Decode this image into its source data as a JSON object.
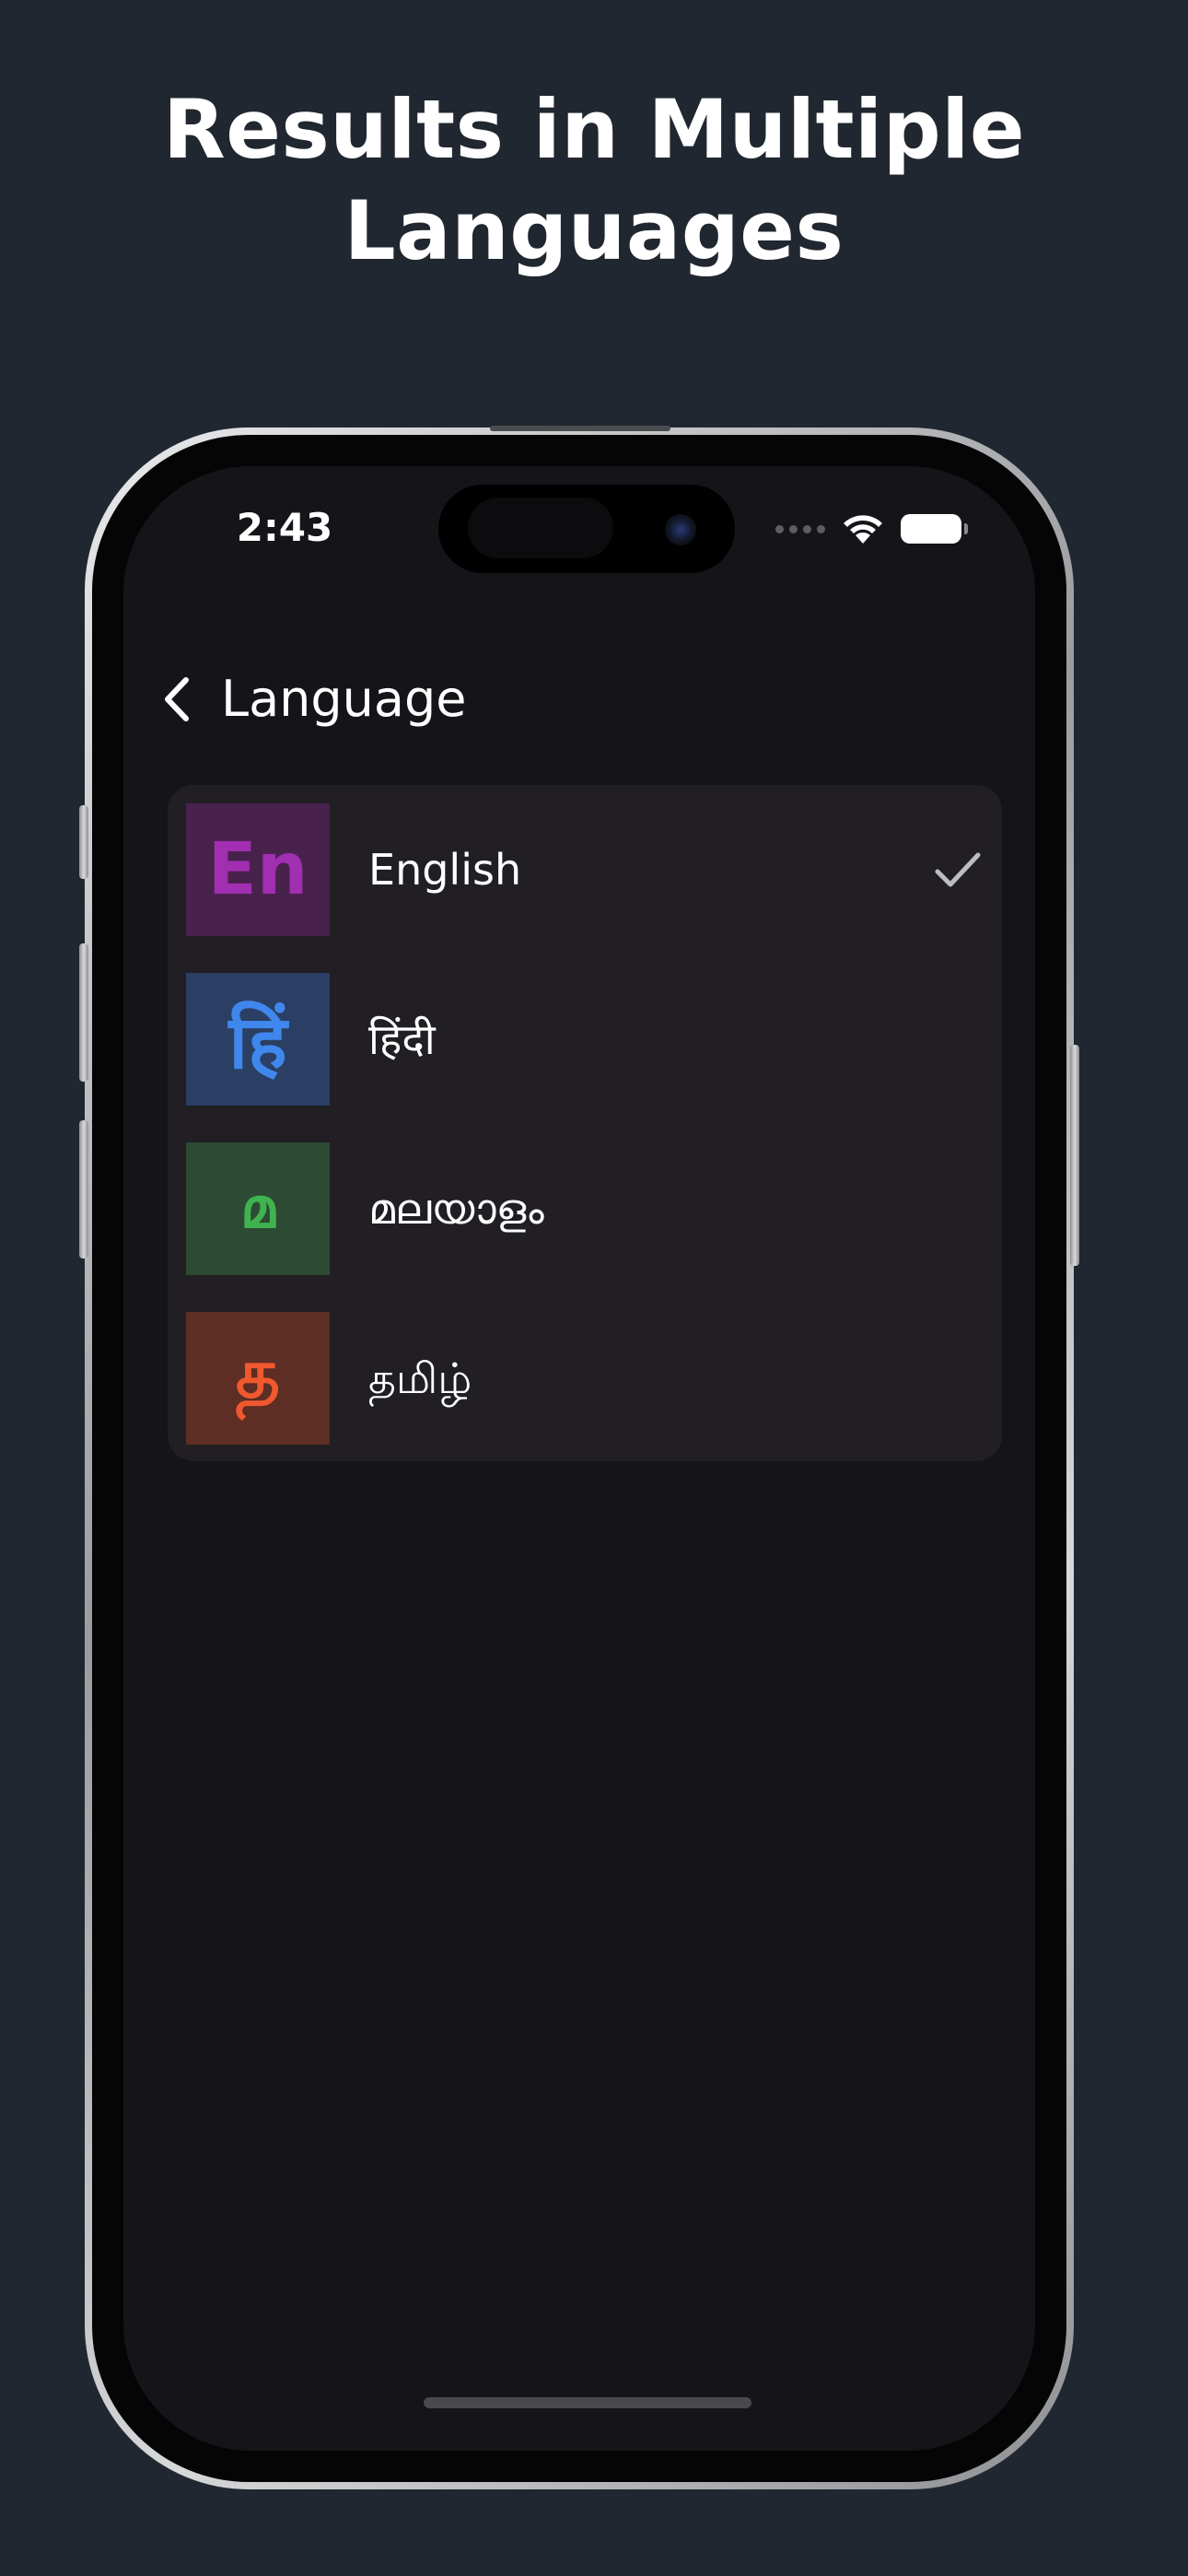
{
  "headline": {
    "line1": "Results in Multiple",
    "line2": "Languages"
  },
  "status_bar": {
    "time": "2:43",
    "icons": [
      "cellular-dots-icon",
      "wifi-icon",
      "battery-icon"
    ]
  },
  "nav": {
    "back_icon": "chevron-left-icon",
    "title": "Language"
  },
  "languages": [
    {
      "badge": "En",
      "label": "English",
      "badge_bg": "#49214d",
      "badge_fg": "#a12fb2",
      "selected": true
    },
    {
      "badge": "हिं",
      "label": "हिंदी",
      "badge_bg": "#2a3f63",
      "badge_fg": "#3f87ec",
      "selected": false
    },
    {
      "badge": "മ",
      "label": "മലയാളം",
      "badge_bg": "#2d4a34",
      "badge_fg": "#3fb34f",
      "selected": false
    },
    {
      "badge": "த",
      "label": "தமிழ்",
      "badge_bg": "#5e2d23",
      "badge_fg": "#f0582e",
      "selected": false
    }
  ],
  "colors": {
    "background": "#212730",
    "screen": "#151419",
    "card": "#211f24",
    "check": "#bdbdbd"
  }
}
